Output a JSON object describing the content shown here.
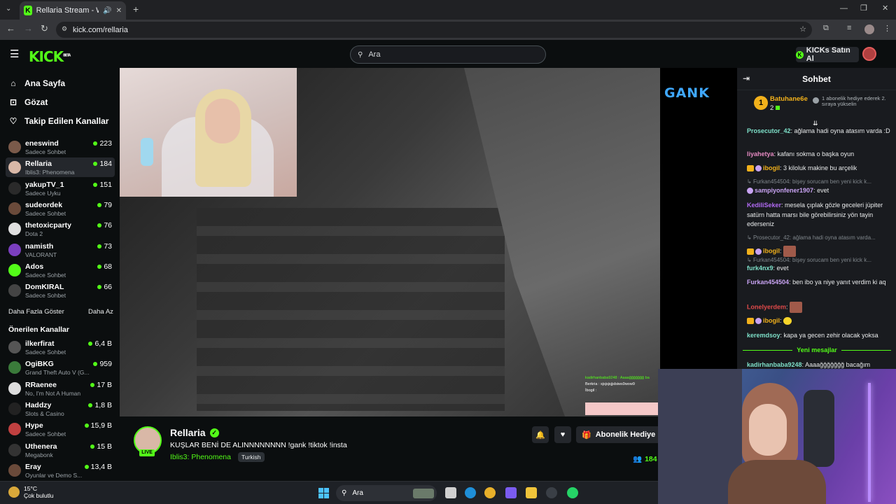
{
  "browser": {
    "tab_title": "Rellaria Stream - Watch Live",
    "url": "kick.com/rellaria"
  },
  "header": {
    "logo": "KICK",
    "logo_beta": "BETA",
    "search_placeholder": "Ara",
    "buy_label": "KICKs Satın Al"
  },
  "sidebar": {
    "nav": [
      {
        "label": "Ana Sayfa",
        "icon": "home-icon"
      },
      {
        "label": "Gözat",
        "icon": "compass-icon"
      },
      {
        "label": "Takip Edilen Kanallar",
        "icon": "heart-icon"
      }
    ],
    "followed": [
      {
        "name": "eneswind",
        "category": "Sadece Sohbet",
        "viewers": "223",
        "color": "#7a5a4a"
      },
      {
        "name": "Rellaria",
        "category": "Iblis3: Phenomena",
        "viewers": "184",
        "color": "#d9b8a7"
      },
      {
        "name": "yakupTV_1",
        "category": "Sadece Uyku",
        "viewers": "151",
        "color": "#2a2a2a"
      },
      {
        "name": "sudeordek",
        "category": "Sadece Sohbet",
        "viewers": "79",
        "color": "#6a4a3a"
      },
      {
        "name": "thetoxicparty",
        "category": "Dota 2",
        "viewers": "76",
        "color": "#e0e0e0"
      },
      {
        "name": "namisth",
        "category": "VALORANT",
        "viewers": "73",
        "color": "#7b3fbf"
      },
      {
        "name": "Ados",
        "category": "Sadece Sohbet",
        "viewers": "68",
        "color": "#53fc18"
      },
      {
        "name": "DomKIRAL",
        "category": "Sadece Sohbet",
        "viewers": "66",
        "color": "#444"
      }
    ],
    "show_more": "Daha Fazla Göster",
    "show_less": "Daha Az",
    "recommended_title": "Önerilen Kanallar",
    "recommended": [
      {
        "name": "ilkerfirat",
        "category": "Sadece Sohbet",
        "viewers": "6,4 B",
        "color": "#555"
      },
      {
        "name": "OgiBKG",
        "category": "Grand Theft Auto V (G...",
        "viewers": "959",
        "color": "#3a7a3a"
      },
      {
        "name": "RRaenee",
        "category": "No, I'm Not A Human",
        "viewers": "17 B",
        "color": "#ddd"
      },
      {
        "name": "Haddzy",
        "category": "Slots & Casino",
        "viewers": "1,8 B",
        "color": "#222"
      },
      {
        "name": "Hype",
        "category": "Sadece Sohbet",
        "viewers": "15,9 B",
        "color": "#c04040"
      },
      {
        "name": "Uthenera",
        "category": "Megabonk",
        "viewers": "15 B",
        "color": "#333"
      },
      {
        "name": "Eray",
        "category": "Oyunlar ve Demo S...",
        "viewers": "13,4 B",
        "color": "#6a4a3a"
      }
    ]
  },
  "video": {
    "overlay_logo": "GANK",
    "mini_chat": [
      "kadirhanbaba9248 : Aaaağğğğğğğ ba",
      "Berkria : sjsjsjsjjslsiws9wow9",
      "İbogil : "
    ]
  },
  "stream": {
    "name": "Rellaria",
    "live_label": "LIVE",
    "title": "KUŞLAR BENİ DE ALINNNNNNNN !gank !tiktok !insta",
    "category": "Iblis3: Phenomena",
    "tag": "Turkish",
    "gift_label": "Abonelik Hediye Et",
    "viewers": "184"
  },
  "chat": {
    "title": "Sohbet",
    "pinned": {
      "rank": "1",
      "user": "Batuhane6e",
      "count": "2",
      "text": "1 abonelik hediye ederek 2. sıraya yükselin"
    },
    "messages": [
      {
        "type": "msg",
        "user": "Prosecutor_42",
        "color": "#7ee0c9",
        "text": "ağlama hadi oyna atasım varda :D"
      },
      {
        "type": "msg",
        "user": "liyahetya",
        "color": "#e58ac2",
        "text": "kafanı sokma o başka oyun"
      },
      {
        "type": "msg",
        "user": "ibogil",
        "color": "#f2b11b",
        "text": "3 kiloluk makine bu arçelik",
        "badges": true
      },
      {
        "type": "reply",
        "text": "Furkan454504: bişey sorucam ben yeni kick k..."
      },
      {
        "type": "msg",
        "user": "sampiyonfener1907",
        "color": "#c8a3f2",
        "text": "evet",
        "badge2": true
      },
      {
        "type": "msg",
        "user": "KediliSeker",
        "color": "#b06af2",
        "text": "mesela çıplak gözle geceleri jüpiter satürn hatta marsı bile görebilirsiniz yön tayin ederseniz"
      },
      {
        "type": "reply",
        "text": "Prosecutor_42: ağlama hadi oyna atasım varda..."
      },
      {
        "type": "msg",
        "user": "ibogil",
        "color": "#f2b11b",
        "text": "",
        "badges": true,
        "emote": "brown"
      },
      {
        "type": "reply",
        "text": "Furkan454504: bişey sorucam ben yeni kick k..."
      },
      {
        "type": "msg",
        "user": "furk4nx9",
        "color": "#7ee0c9",
        "text": "evet"
      },
      {
        "type": "msg",
        "user": "Furkan454504",
        "color": "#c8a3f2",
        "text": "ben ibo ya niye yanıt verdim ki aq"
      },
      {
        "type": "msg",
        "user": "Lonelyerdem",
        "color": "#e04a4a",
        "text": "",
        "emote": "brown"
      },
      {
        "type": "msg",
        "user": "ibogil",
        "color": "#f2b11b",
        "text": "",
        "badges": true,
        "emote": "yellow"
      },
      {
        "type": "msg",
        "user": "keremdsoy",
        "color": "#7ee0c9",
        "text": "kapa ya gecen zehir olacak yoksa"
      }
    ],
    "new_messages": "Yeni mesajlar",
    "last_message": {
      "user": "kadirhanbaba9248",
      "color": "#7ee0c9",
      "text": "Aaaağğğğğğğ bacağım"
    }
  },
  "taskbar": {
    "temperature": "15°C",
    "weather": "Çok bulutlu",
    "search": "Ara"
  }
}
